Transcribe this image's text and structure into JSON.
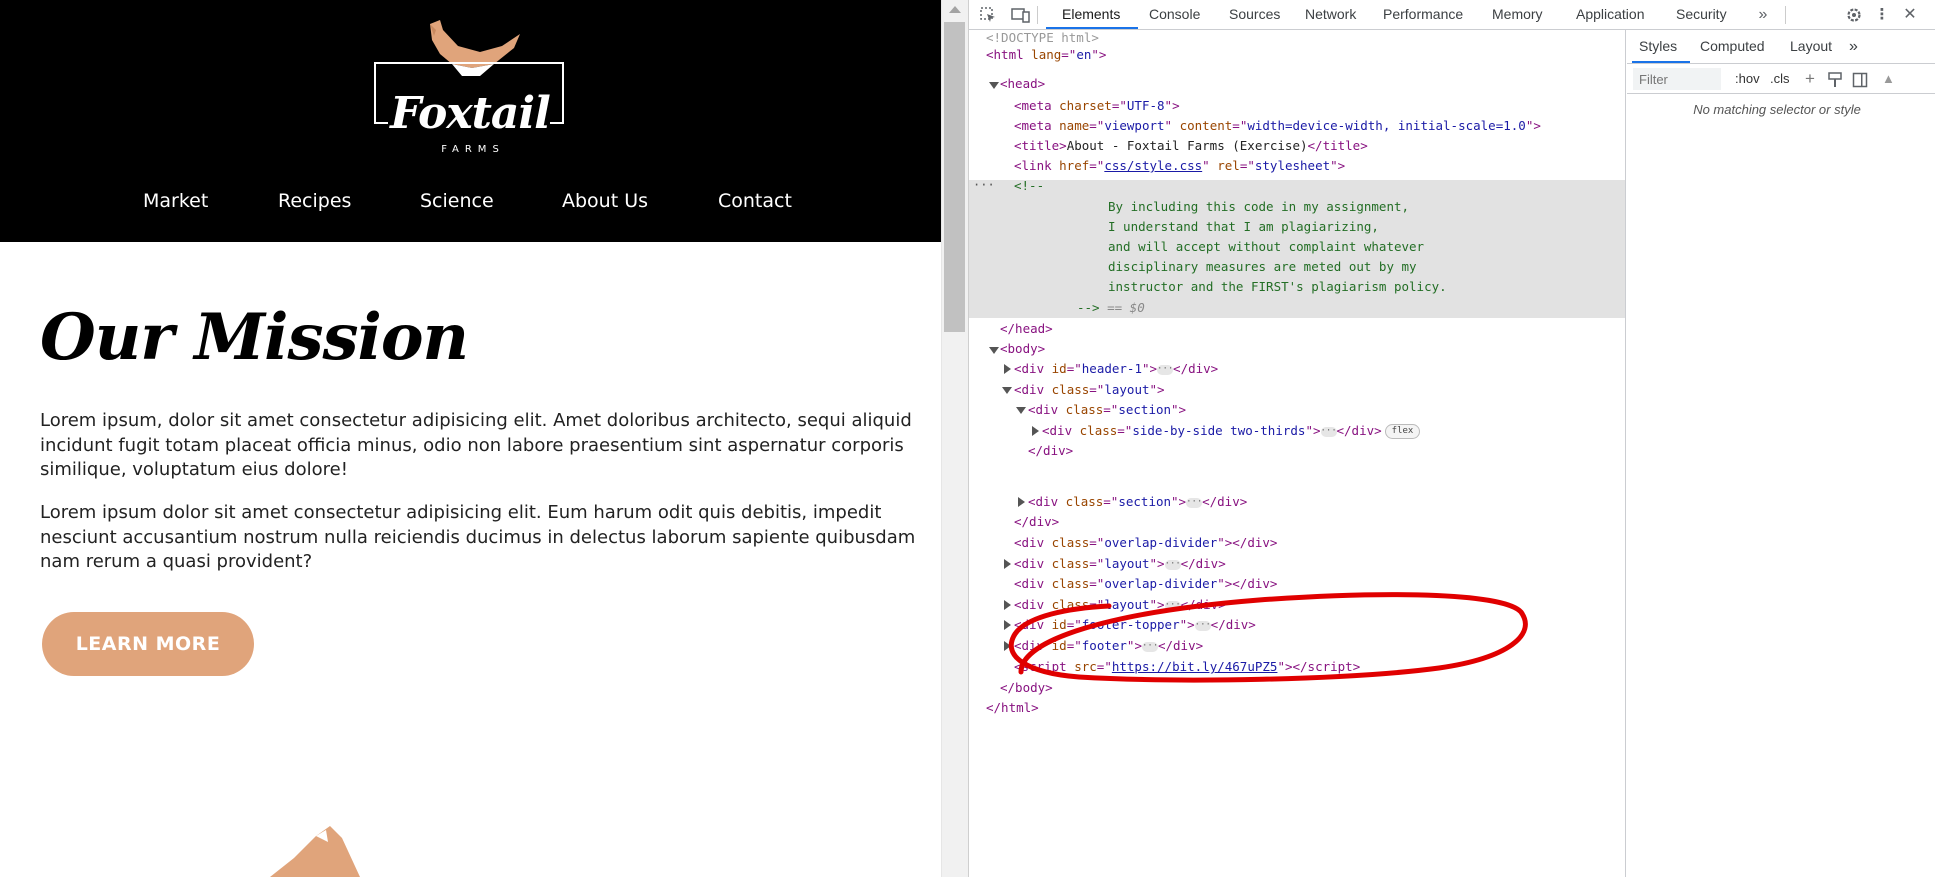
{
  "site": {
    "logo": {
      "wordmark": "Foxtail",
      "subtext": "FARMS"
    },
    "nav": [
      "Market",
      "Recipes",
      "Science",
      "About Us",
      "Contact"
    ],
    "mission_title": "Our Mission",
    "paragraphs": [
      "Lorem ipsum, dolor sit amet consectetur adipisicing elit. Amet doloribus architecto, sequi aliquid incidunt fugit totam placeat officia minus, odio non labore praesentium sint aspernatur corporis similique, voluptatum eius dolore!",
      "Lorem ipsum dolor sit amet consectetur adipisicing elit. Eum harum odit quis debitis, impedit nesciunt accusantium nostrum nulla reiciendis ducimus in delectus laborum sapiente quibusdam nam rerum a quasi provident?"
    ],
    "cta_label": "LEARN MORE",
    "colors": {
      "accent": "#e0a47b",
      "header_bg": "#000000"
    }
  },
  "devtools": {
    "tabs": [
      "Elements",
      "Console",
      "Sources",
      "Network",
      "Performance",
      "Memory",
      "Application",
      "Security"
    ],
    "active_tab": "Elements",
    "icons": [
      "inspect-icon",
      "device-toolbar-icon",
      "more-tabs-icon",
      "settings-icon",
      "kebab-menu-icon"
    ],
    "dom": {
      "doctype": "<!DOCTYPE html>",
      "html_open": {
        "tag": "html",
        "attr": "lang",
        "val": "en"
      },
      "head": "head",
      "meta_charset": {
        "attr": "charset",
        "val": "UTF-8"
      },
      "meta_viewport": {
        "attr1": "name",
        "val1": "viewport",
        "attr2": "content",
        "val2": "width=device-width, initial-scale=1.0"
      },
      "title_text": "About - Foxtail Farms (Exercise)",
      "link": {
        "attr1": "href",
        "val1": "css/style.css",
        "attr2": "rel",
        "val2": "stylesheet"
      },
      "comment_open": "<!--",
      "comment_lines": [
        "By including this code in my assignment,",
        "I understand that I am plagiarizing,",
        "and will accept without complaint whatever",
        "disciplinary measures are meted out by my",
        "instructor and the FIRST's plagiarism policy."
      ],
      "comment_close": "-->",
      "eq_marker": "== $0",
      "header_id": "header-1",
      "layout_class": "layout",
      "section_class": "section",
      "side_class": "side-by-side two-thirds",
      "flex_badge": "flex",
      "overlap_class": "overlap-divider",
      "footer_topper_id": "footer-topper",
      "footer_id": "footer",
      "script_src": "https://bit.ly/467uPZ5"
    },
    "styles_pane": {
      "tabs": [
        "Styles",
        "Computed",
        "Layout"
      ],
      "active_tab": "Styles",
      "filter_placeholder": "Filter",
      "hov": ":hov",
      "cls": ".cls",
      "empty_message": "No matching selector or style"
    }
  }
}
